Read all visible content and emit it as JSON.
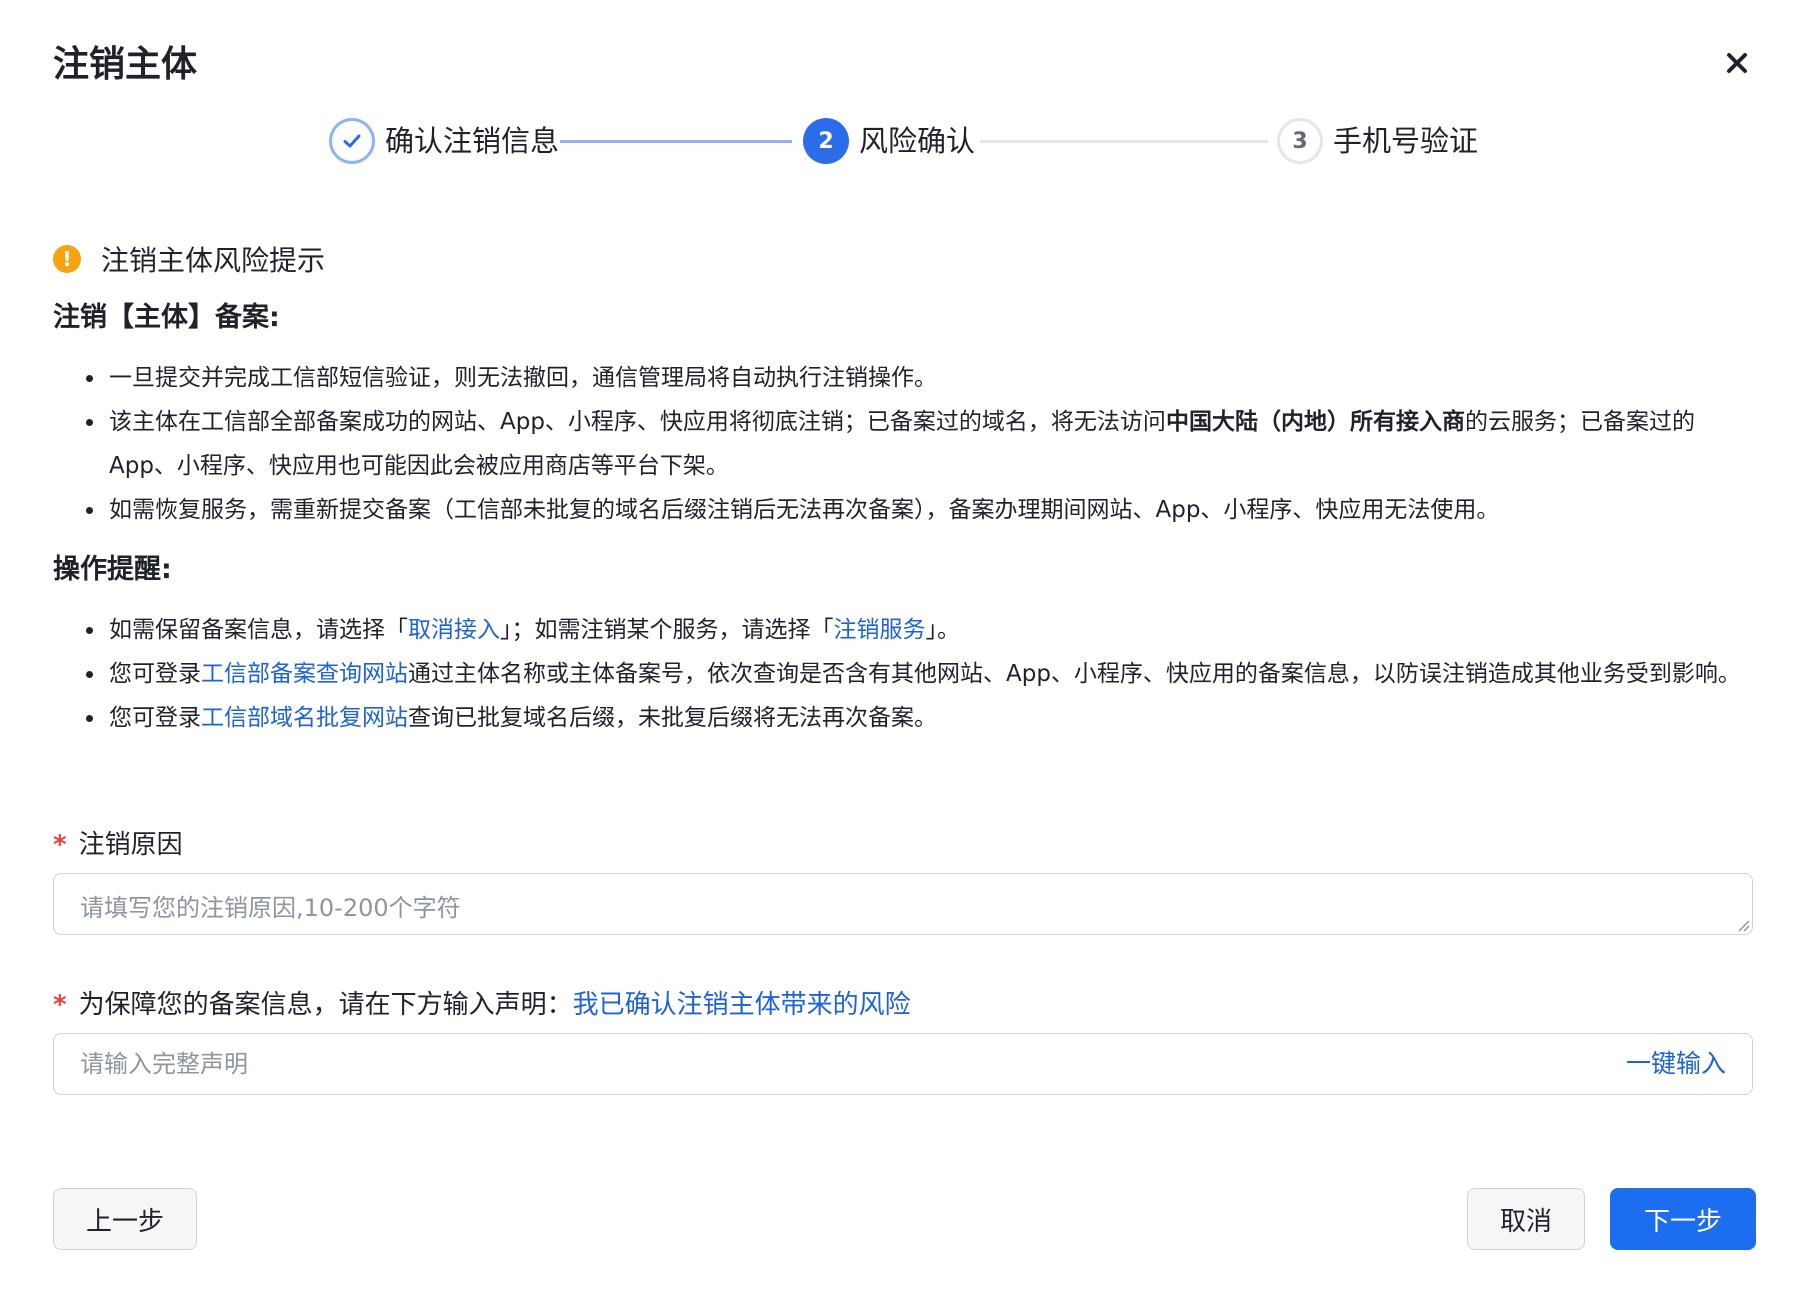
{
  "dialog": {
    "title": "注销主体"
  },
  "steps": [
    {
      "number": "",
      "label": "确认注销信息",
      "status": "done"
    },
    {
      "number": "2",
      "label": "风险确认",
      "status": "active"
    },
    {
      "number": "3",
      "label": "手机号验证",
      "status": "todo"
    }
  ],
  "alert": {
    "icon": "warning-icon",
    "text": "注销主体风险提示"
  },
  "risk_section": {
    "heading": "注销【主体】备案:",
    "items": [
      {
        "text": "一旦提交并完成工信部短信验证，则无法撤回，通信管理局将自动执行注销操作。"
      },
      {
        "pre": "该主体在工信部全部备案成功的网站、App、小程序、快应用将彻底注销；已备案过的域名，将无法访问",
        "bold": "中国大陆（内地）所有接入商",
        "post": "的云服务；已备案过的 App、小程序、快应用也可能因此会被应用商店等平台下架。"
      },
      {
        "text": "如需恢复服务，需重新提交备案（工信部未批复的域名后缀注销后无法再次备案），备案办理期间网站、App、小程序、快应用无法使用。"
      }
    ]
  },
  "ops_section": {
    "heading": "操作提醒:",
    "item1": {
      "pre": "如需保留备案信息，请选择「",
      "link1": "取消接入",
      "mid": "」；如需注销某个服务，请选择「",
      "link2": "注销服务",
      "post": "」。"
    },
    "item2": {
      "pre": "您可登录",
      "link": "工信部备案查询网站",
      "post": "通过主体名称或主体备案号，依次查询是否含有其他网站、App、小程序、快应用的备案信息，以防误注销造成其他业务受到影响。"
    },
    "item3": {
      "pre": "您可登录",
      "link": "工信部域名批复网站",
      "post": "查询已批复域名后缀，未批复后缀将无法再次备案。"
    }
  },
  "form": {
    "required_mark": "*",
    "reason_label": "注销原因",
    "reason_placeholder": "请填写您的注销原因,10-200个字符",
    "statement_label": "为保障您的备案信息，请在下方输入声明：",
    "statement_text": "我已确认注销主体带来的风险",
    "statement_placeholder": "请输入完整声明",
    "autofill_label": "一键输入"
  },
  "footer": {
    "prev_label": "上一步",
    "cancel_label": "取消",
    "next_label": "下一步"
  },
  "colors": {
    "primary": "#1c6df0",
    "link": "#1e63d6",
    "warning": "#f5a40f",
    "required": "#e5453a"
  }
}
